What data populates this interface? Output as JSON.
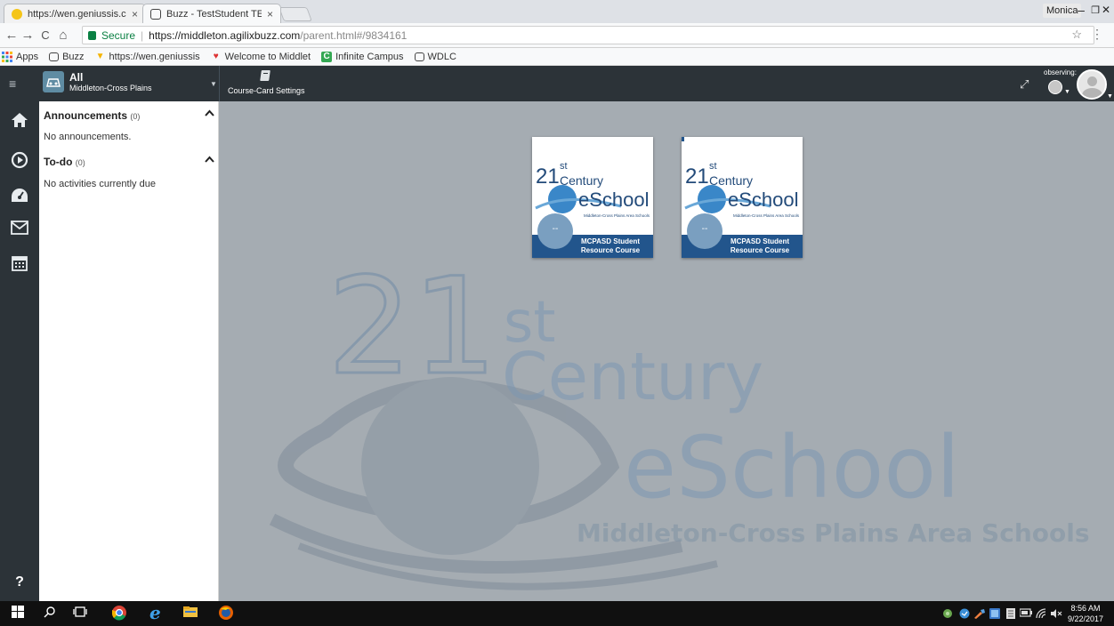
{
  "browser": {
    "tabs": [
      {
        "title": "https://wen.geniussis.co",
        "close": "×"
      },
      {
        "title": "Buzz - TestStudent TEST",
        "close": "×"
      }
    ],
    "user_button": "Monica",
    "window_controls": {
      "minimize": "–",
      "maximize": "❐",
      "close": "✕"
    },
    "nav": {
      "back": "←",
      "forward": "→",
      "reload": "C",
      "home": "⌂"
    },
    "secure_label": "Secure",
    "url_host": "https://middleton.agilixbuzz.com",
    "url_path": "/parent.html#/9834161",
    "star": "☆",
    "menu": "⋮"
  },
  "bookmarks": [
    {
      "label": "Apps",
      "icon": "apps-grid-icon"
    },
    {
      "label": "Buzz",
      "icon": "buzz-icon"
    },
    {
      "label": "https://wen.geniussis",
      "icon": "genius-icon"
    },
    {
      "label": "Welcome to Middlet",
      "icon": "mcpasd-icon"
    },
    {
      "label": "Infinite Campus",
      "icon": "infinite-campus-icon"
    },
    {
      "label": "WDLC",
      "icon": "buzz-icon"
    }
  ],
  "header": {
    "menu_icon": "≡",
    "domain_line1": "All",
    "domain_line2": "Middleton-Cross Plains",
    "settings_label": "Course-Card Settings",
    "observing_label": "observing:"
  },
  "sidebar": {
    "sections": [
      {
        "title": "Announcements",
        "count": "(0)",
        "empty_text": "No announcements."
      },
      {
        "title": "To-do",
        "count": "(0)",
        "empty_text": "No activities currently due"
      }
    ],
    "help": "?"
  },
  "cards": [
    {
      "logo_num": "21",
      "logo_sup": "st",
      "logo_century": "Century",
      "logo_eschool": "eSchool",
      "logo_district": "Middleton-Cross Plains Area Schools",
      "badge": "--",
      "title_line1": "MCPASD Student",
      "title_line2": "Resource Course"
    },
    {
      "logo_num": "21",
      "logo_sup": "st",
      "logo_century": "Century",
      "logo_eschool": "eSchool",
      "logo_district": "Middleton-Cross Plains Area Schools",
      "badge": "--",
      "title_line1": "MCPASD Student",
      "title_line2": "Resource Course"
    }
  ],
  "background_logo": {
    "num": "21",
    "sup": "st",
    "century": "Century",
    "eschool": "eSchool",
    "district": "Middleton-Cross Plains Area Schools"
  },
  "taskbar": {
    "clock_time": "8:56 AM",
    "clock_date": "9/22/2017"
  },
  "colors": {
    "app_header": "#2c3338",
    "main_bg": "#a5acb2",
    "card_footer": "#22558c",
    "secure_green": "#0b8043"
  }
}
